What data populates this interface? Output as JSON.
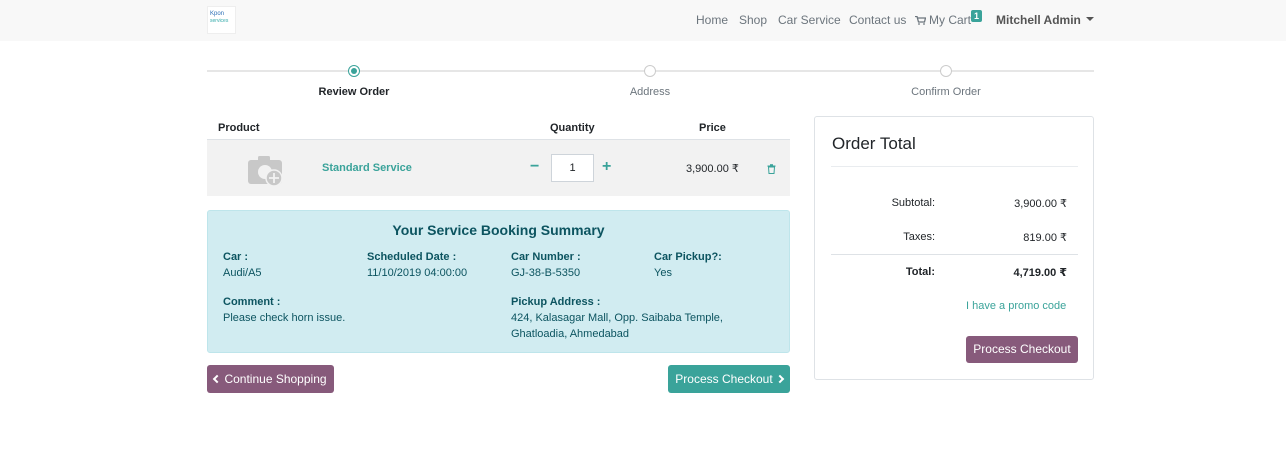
{
  "brand": {
    "logo_line1": "Kpon",
    "logo_line2": "services"
  },
  "nav": {
    "home": "Home",
    "shop": "Shop",
    "car_service": "Car Service",
    "contact": "Contact us",
    "cart": "My Cart",
    "cart_count": "1",
    "user": "Mitchell Admin"
  },
  "wizard": {
    "steps": [
      "Review Order",
      "Address",
      "Confirm Order"
    ],
    "active_step": 0
  },
  "cart_table": {
    "headers": {
      "product": "Product",
      "quantity": "Quantity",
      "price": "Price"
    },
    "rows": [
      {
        "name": "Standard Service",
        "quantity": "1",
        "price": "3,900.00 ₹"
      }
    ]
  },
  "summary": {
    "title": "Your Service Booking Summary",
    "car_label": "Car :",
    "car_value": "Audi/A5",
    "date_label": "Scheduled Date :",
    "date_value": "11/10/2019 04:00:00",
    "number_label": "Car Number :",
    "number_value": "GJ-38-B-5350",
    "pickup_label": "Car Pickup?:",
    "pickup_value": "Yes",
    "comment_label": "Comment :",
    "comment_value": "Please check horn issue.",
    "address_label": "Pickup Address :",
    "address_line1": "424, Kalasagar Mall, Opp. Saibaba Temple,",
    "address_line2": "Ghatloadia, Ahmedabad"
  },
  "buttons": {
    "continue": "Continue Shopping",
    "process": "Process Checkout"
  },
  "order_total": {
    "title": "Order Total",
    "subtotal_label": "Subtotal:",
    "subtotal_value": "3,900.00 ₹",
    "taxes_label": "Taxes:",
    "taxes_value": "819.00 ₹",
    "total_label": "Total:",
    "total_value": "4,719.00 ₹",
    "promo": "I have a promo code",
    "process": "Process Checkout"
  },
  "colors": {
    "accent": "#3aa39a",
    "primary": "#875a7b",
    "summary_bg": "#d1ecf1"
  }
}
